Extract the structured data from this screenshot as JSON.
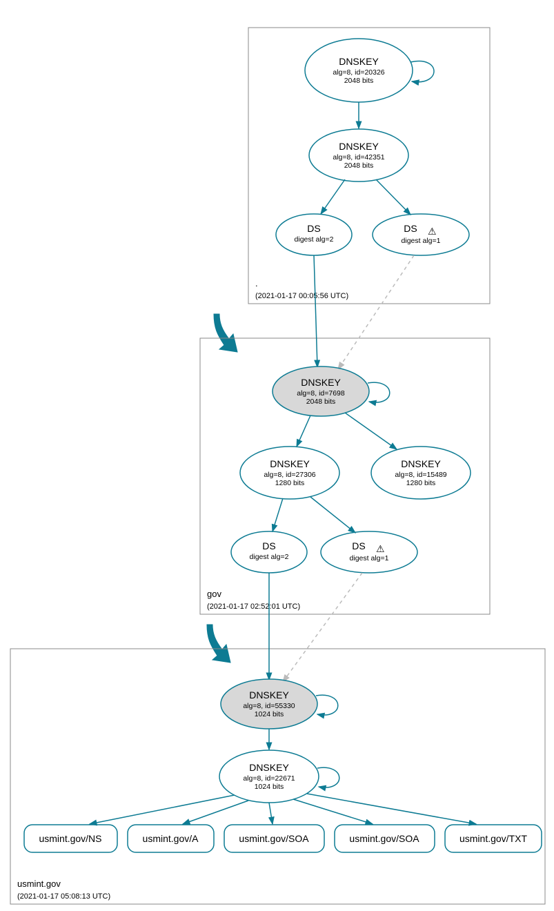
{
  "zones": {
    "root": {
      "name": ".",
      "timestamp": "(2021-01-17 00:05:56 UTC)"
    },
    "gov": {
      "name": "gov",
      "timestamp": "(2021-01-17 02:52:01 UTC)"
    },
    "usmint": {
      "name": "usmint.gov",
      "timestamp": "(2021-01-17 05:08:13 UTC)"
    }
  },
  "nodes": {
    "root_ksk": {
      "title": "DNSKEY",
      "line1": "alg=8, id=20326",
      "line2": "2048 bits"
    },
    "root_zsk": {
      "title": "DNSKEY",
      "line1": "alg=8, id=42351",
      "line2": "2048 bits"
    },
    "root_ds2": {
      "title": "DS",
      "line1": "digest alg=2"
    },
    "root_ds1": {
      "title": "DS",
      "line1": "digest alg=1"
    },
    "gov_ksk": {
      "title": "DNSKEY",
      "line1": "alg=8, id=7698",
      "line2": "2048 bits"
    },
    "gov_zsk1": {
      "title": "DNSKEY",
      "line1": "alg=8, id=27306",
      "line2": "1280 bits"
    },
    "gov_zsk2": {
      "title": "DNSKEY",
      "line1": "alg=8, id=15489",
      "line2": "1280 bits"
    },
    "gov_ds2": {
      "title": "DS",
      "line1": "digest alg=2"
    },
    "gov_ds1": {
      "title": "DS",
      "line1": "digest alg=1"
    },
    "us_ksk": {
      "title": "DNSKEY",
      "line1": "alg=8, id=55330",
      "line2": "1024 bits"
    },
    "us_zsk": {
      "title": "DNSKEY",
      "line1": "alg=8, id=22671",
      "line2": "1024 bits"
    }
  },
  "records": {
    "ns": "usmint.gov/NS",
    "a": "usmint.gov/A",
    "soa1": "usmint.gov/SOA",
    "soa2": "usmint.gov/SOA",
    "txt": "usmint.gov/TXT"
  },
  "warn_icon": "⚠"
}
